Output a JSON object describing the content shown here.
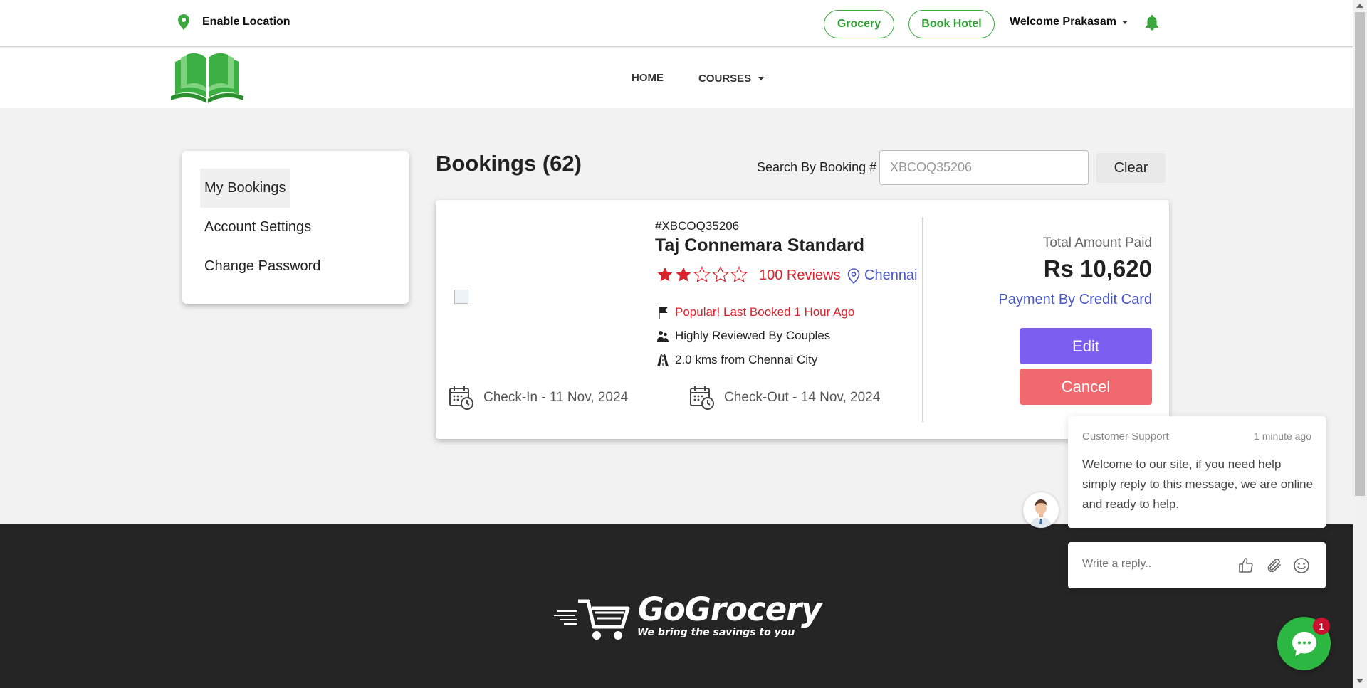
{
  "topbar": {
    "location_label": "Enable Location",
    "grocery_label": "Grocery",
    "hotel_label": "Book Hotel",
    "welcome_label": "Welcome Prakasam"
  },
  "nav": {
    "home_label": "HOME",
    "courses_label": "COURSES"
  },
  "sidebar": {
    "items": [
      {
        "label": "My Bookings"
      },
      {
        "label": "Account Settings"
      },
      {
        "label": "Change Password"
      }
    ]
  },
  "bookings": {
    "title": "Bookings (62)",
    "search_label": "Search By Booking #",
    "search_value": "XBCOQ35206",
    "clear_label": "Clear"
  },
  "booking": {
    "number": "#XBCOQ35206",
    "hotel_name": "Taj Connemara Standard",
    "rating": 2,
    "rating_max": 5,
    "reviews": "100 Reviews",
    "city": "Chennai",
    "popular": "Popular! Last Booked 1 Hour Ago",
    "couples": "Highly Reviewed By Couples",
    "distance": "2.0 kms from Chennai City",
    "checkin": "Check-In - 11 Nov, 2024",
    "checkout": "Check-Out - 14 Nov, 2024",
    "amount_label": "Total Amount Paid",
    "amount": "Rs 10,620",
    "payment": "Payment By Credit Card",
    "edit_label": "Edit",
    "cancel_label": "Cancel"
  },
  "footer": {
    "brand_name": "GoGrocery",
    "brand_tagline": "We bring the savings to you"
  },
  "chat": {
    "sender": "Customer Support",
    "time": "1 minute ago",
    "message": "Welcome to our site, if you need help simply reply to this message, we are online and ready to help.",
    "reply_placeholder": "Write a reply..",
    "badge_count": "1"
  },
  "colors": {
    "brand_green": "#2f9f32",
    "edit_purple": "#7c5ef0",
    "cancel_red": "#f0696e",
    "review_red": "#d9232d",
    "link_blue": "#4a57c7",
    "chat_green": "#2cb742"
  },
  "icons": [
    "map-pin-icon",
    "bell-icon",
    "book-logo",
    "star-icon",
    "location-pin-icon",
    "flag-icon",
    "users-icon",
    "road-icon",
    "calendar-clock-icon",
    "thumbs-up-icon",
    "paperclip-icon",
    "smiley-icon",
    "chat-bubble-icon",
    "cart-logo"
  ]
}
